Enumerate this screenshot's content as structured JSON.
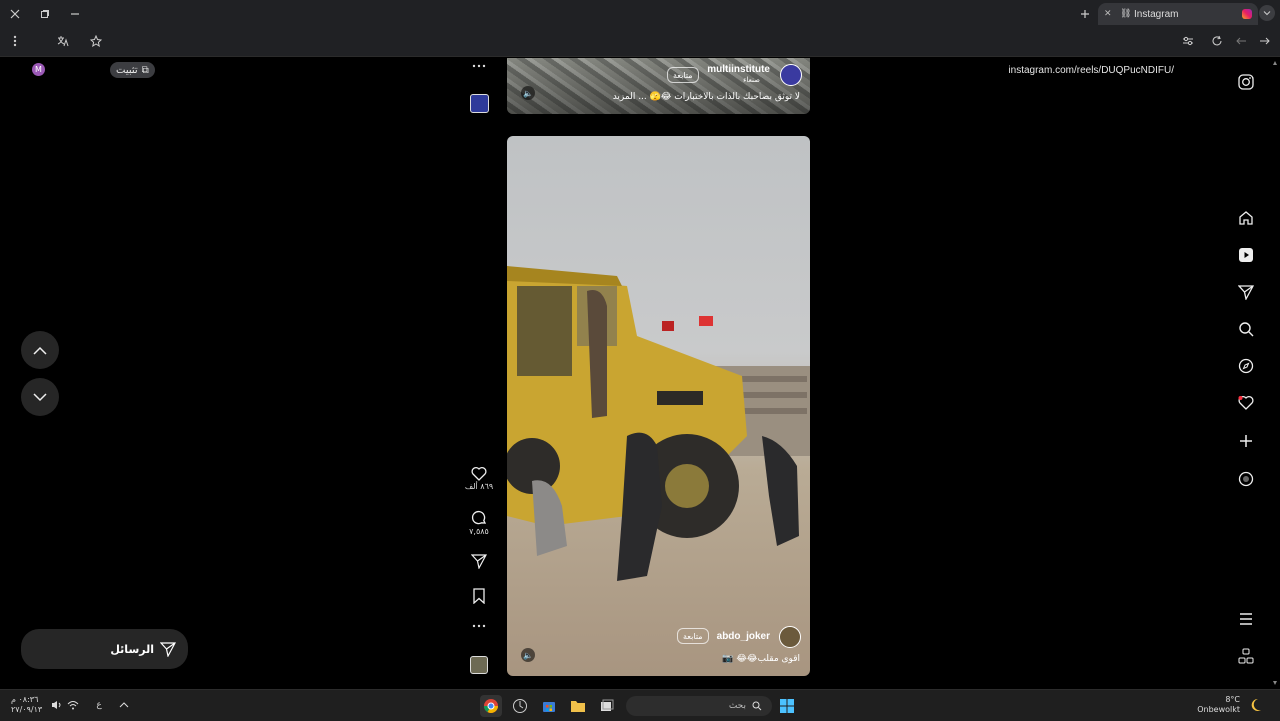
{
  "browser": {
    "tab_title": "Instagram",
    "url": "instagram.com/reels/DUQPucNDIFU/",
    "pin_label": "تثبيت",
    "profile_initial": "M"
  },
  "reel_previous": {
    "username": "multiinstitute",
    "location": "صنعاء",
    "follow_label": "متابعة",
    "caption": "لا توثق بصاحبك بالذات بالاختبارات 😂🫣 ... المزيد"
  },
  "reel_current": {
    "username": "abdo_joker",
    "follow_label": "متابعة",
    "caption": "اقوى مقلب😂😂 📷"
  },
  "actions": {
    "likes": "٨٦٩ ألف",
    "comments": "٧,٥٨٥"
  },
  "left": {
    "messages_label": "الرسائل"
  },
  "taskbar": {
    "search_placeholder": "بحث",
    "time": "٠٨:٣٦ م",
    "date": "٢٧/٠٩/١٣",
    "language": "ع",
    "temperature": "8°C",
    "weather_text": "Onbewolkt"
  },
  "colors": {
    "background": "#000000",
    "chrome": "#202124",
    "notification_dot": "#ff3040"
  }
}
